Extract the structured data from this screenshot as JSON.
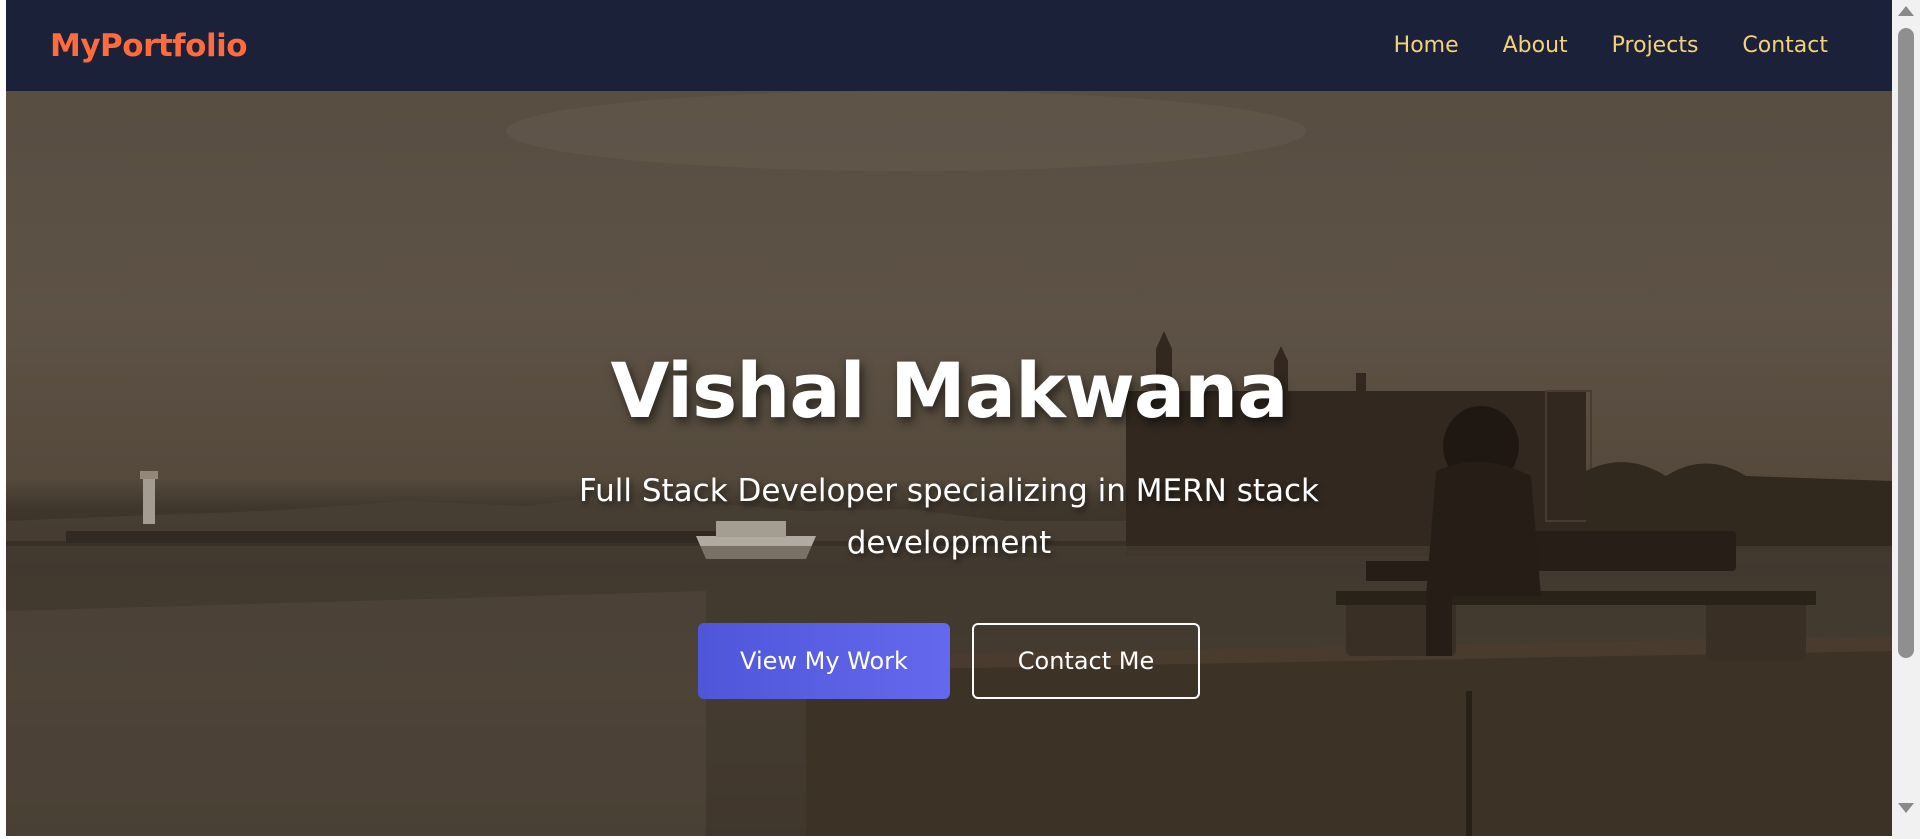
{
  "brand": "MyPortfolio",
  "nav": {
    "home": "Home",
    "about": "About",
    "projects": "Projects",
    "contact": "Contact"
  },
  "hero": {
    "title": "Vishal Makwana",
    "subtitle": "Full Stack Developer specializing in MERN stack development",
    "primary_button": "View My Work",
    "secondary_button": "Contact Me"
  },
  "colors": {
    "navbar_bg": "#1b2138",
    "brand": "#ff6b3d",
    "nav_link": "#f4d27a",
    "primary_button": "#5a5fe6"
  }
}
